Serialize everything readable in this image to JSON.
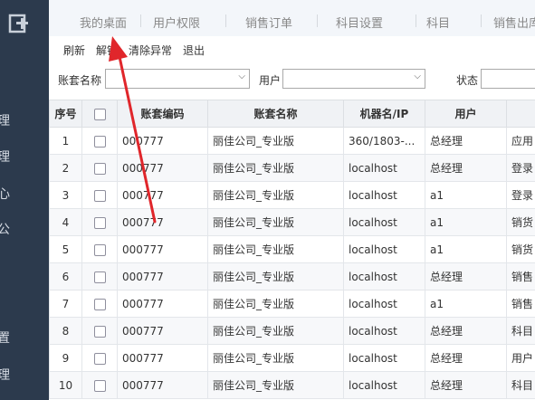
{
  "sidebar": {
    "chars": [
      "理",
      "理",
      "心",
      "公",
      "置",
      "理"
    ]
  },
  "topnav": {
    "tabs": [
      "我的桌面",
      "用户权限",
      "销售订单",
      "科目设置",
      "科目",
      "销售出库"
    ]
  },
  "toolbar": {
    "refresh": "刷新",
    "unlock": "解锁",
    "clear_errors": "清除异常",
    "exit": "退出"
  },
  "filter": {
    "account_name_label": "账套名称",
    "user_label": "用户",
    "status_label": "状态"
  },
  "table": {
    "headers": [
      "序号",
      "",
      "账套编码",
      "账套名称",
      "机器名/IP",
      "用户",
      ""
    ],
    "rows": [
      [
        "1",
        "000777",
        "丽佳公司_专业版",
        "360/1803-...",
        "总经理",
        "应用"
      ],
      [
        "2",
        "000777",
        "丽佳公司_专业版",
        "localhost",
        "总经理",
        "登录"
      ],
      [
        "3",
        "000777",
        "丽佳公司_专业版",
        "localhost",
        "a1",
        "登录"
      ],
      [
        "4",
        "000777",
        "丽佳公司_专业版",
        "localhost",
        "a1",
        "销货"
      ],
      [
        "5",
        "000777",
        "丽佳公司_专业版",
        "localhost",
        "a1",
        "销货"
      ],
      [
        "6",
        "000777",
        "丽佳公司_专业版",
        "localhost",
        "总经理",
        "销售"
      ],
      [
        "7",
        "000777",
        "丽佳公司_专业版",
        "localhost",
        "a1",
        "销售"
      ],
      [
        "8",
        "000777",
        "丽佳公司_专业版",
        "localhost",
        "总经理",
        "科目"
      ],
      [
        "9",
        "000777",
        "丽佳公司_专业版",
        "localhost",
        "总经理",
        "用户"
      ],
      [
        "10",
        "000777",
        "丽佳公司_专业版",
        "localhost",
        "总经理",
        "科目"
      ]
    ]
  },
  "colors": {
    "sidebar_bg": "#2c3a4d",
    "annotation_arrow": "#e0262b"
  }
}
